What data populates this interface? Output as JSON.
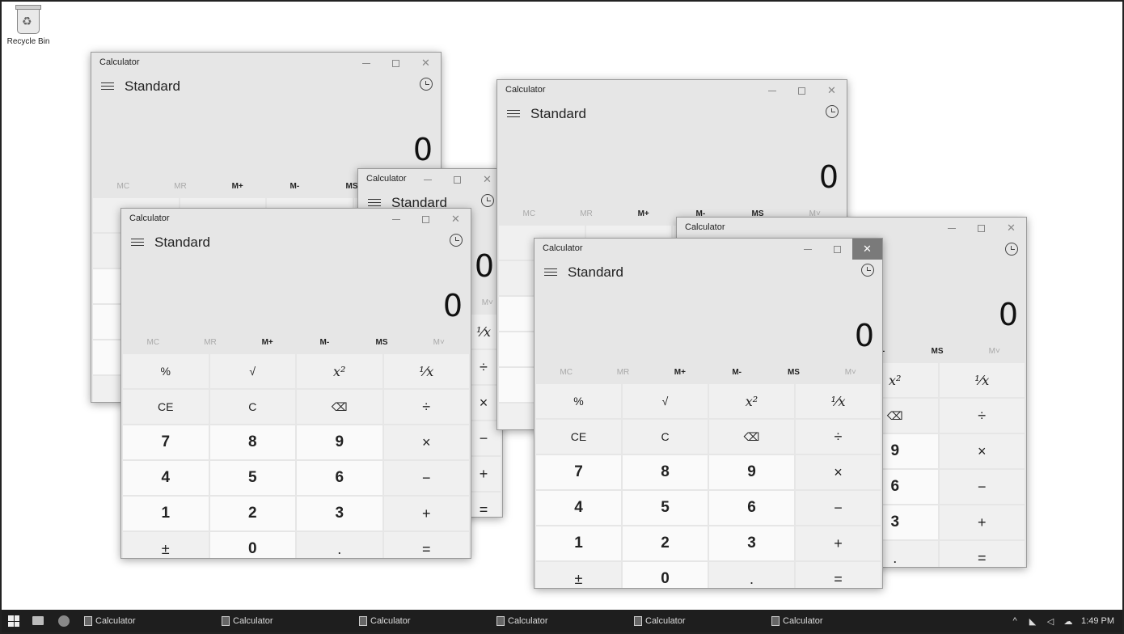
{
  "desktop": {
    "recycle_bin_label": "Recycle Bin"
  },
  "calc": {
    "title": "Calculator",
    "mode": "Standard",
    "display": "0",
    "memory": [
      "MC",
      "MR",
      "M+",
      "M-",
      "MS",
      "M˅"
    ],
    "keys": [
      "%",
      "√",
      "x²",
      "¹⁄x",
      "CE",
      "C",
      "⌫",
      "÷",
      "7",
      "8",
      "9",
      "×",
      "4",
      "5",
      "6",
      "−",
      "1",
      "2",
      "3",
      "+",
      "±",
      "0",
      ".",
      "="
    ],
    "caption": {
      "minimize": "—",
      "maximize": "☐",
      "close": "✕"
    }
  },
  "taskbar": {
    "items": [
      "Calculator",
      "Calculator",
      "Calculator",
      "Calculator",
      "Calculator",
      "Calculator"
    ],
    "time": "1:49 PM"
  },
  "colors": {
    "window_bg": "#e6e6e6",
    "key_bg": "#f0f0f0",
    "num_key_bg": "#fafafa",
    "taskbar_bg": "#1e1e1e",
    "close_active": "#7a7a7a"
  }
}
